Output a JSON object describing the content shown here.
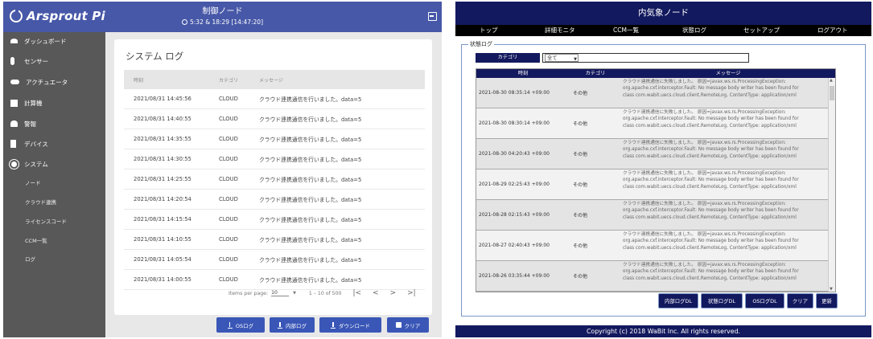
{
  "left": {
    "logo": "Arsprout Pi",
    "title": "制御ノード",
    "status": "5:32 & 18:29 [14:47:20]",
    "sidebar": {
      "items": [
        {
          "label": "ダッシュボード",
          "icon": "dashboard-icon"
        },
        {
          "label": "センサー",
          "icon": "sensor-icon"
        },
        {
          "label": "アクチュエータ",
          "icon": "actuator-icon"
        },
        {
          "label": "計算機",
          "icon": "calculator-icon"
        },
        {
          "label": "警報",
          "icon": "alarm-icon"
        },
        {
          "label": "デバイス",
          "icon": "device-icon"
        },
        {
          "label": "システム",
          "icon": "gear-icon"
        }
      ],
      "sub_items": [
        "ノード",
        "クラウド連携",
        "ライセンスコード",
        "CCM一覧",
        "ログ"
      ]
    },
    "page_title": "システム ログ",
    "table": {
      "headers": {
        "time": "時刻",
        "category": "カテゴリ",
        "message": "メッセージ"
      },
      "rows": [
        {
          "time": "2021/08/31 14:45:56",
          "category": "CLOUD",
          "message": "クラウド連携通信を行いました。data=5"
        },
        {
          "time": "2021/08/31 14:40:55",
          "category": "CLOUD",
          "message": "クラウド連携通信を行いました。data=5"
        },
        {
          "time": "2021/08/31 14:35:55",
          "category": "CLOUD",
          "message": "クラウド連携通信を行いました。data=5"
        },
        {
          "time": "2021/08/31 14:30:55",
          "category": "CLOUD",
          "message": "クラウド連携通信を行いました。data=5"
        },
        {
          "time": "2021/08/31 14:25:55",
          "category": "CLOUD",
          "message": "クラウド連携通信を行いました。data=5"
        },
        {
          "time": "2021/08/31 14:20:54",
          "category": "CLOUD",
          "message": "クラウド連携通信を行いました。data=5"
        },
        {
          "time": "2021/08/31 14:15:54",
          "category": "CLOUD",
          "message": "クラウド連携通信を行いました。data=5"
        },
        {
          "time": "2021/08/31 14:10:55",
          "category": "CLOUD",
          "message": "クラウド連携通信を行いました。data=5"
        },
        {
          "time": "2021/08/31 14:05:54",
          "category": "CLOUD",
          "message": "クラウド連携通信を行いました。data=5"
        },
        {
          "time": "2021/08/31 14:00:55",
          "category": "CLOUD",
          "message": "クラウド連携通信を行いました。data=5"
        }
      ]
    },
    "pager": {
      "items_per_page_label": "Items per page:",
      "items_per_page": "10",
      "range": "1 – 10 of 500",
      "first": "|<",
      "prev": "<",
      "next": ">",
      "last": ">|"
    },
    "buttons": {
      "os_log": "OSログ",
      "internal_log": "内部ログ",
      "download": "ダウンロード",
      "clear": "クリア"
    }
  },
  "right": {
    "title": "内気象ノード",
    "menu": [
      "トップ",
      "詳細モニタ",
      "CCM一覧",
      "状態ログ",
      "セットアップ",
      "ログアウト"
    ],
    "legend": "状態ログ",
    "category_label": "カテゴリ",
    "category_value": "全て",
    "table": {
      "headers": {
        "time": "時刻",
        "category": "カテゴリ",
        "message": "メッセージ"
      },
      "rows": [
        {
          "time": "2021-08-30 08:35:14 +09:00",
          "category": "その他"
        },
        {
          "time": "2021-08-30 08:30:14 +09:00",
          "category": "その他"
        },
        {
          "time": "2021-08-30 04:20:43 +09:00",
          "category": "その他"
        },
        {
          "time": "2021-08-29 02:25:43 +09:00",
          "category": "その他"
        },
        {
          "time": "2021-08-28 02:15:43 +09:00",
          "category": "その他"
        },
        {
          "time": "2021-08-27 02:40:43 +09:00",
          "category": "その他"
        },
        {
          "time": "2021-08-26 03:35:44 +09:00",
          "category": "その他"
        }
      ],
      "message_lines": [
        "クラウド連携通信に失敗しました。 原因=javax.ws.rs.ProcessingException:",
        "org.apache.cxf.interceptor.Fault: No message body writer has been found for",
        "class com.wabit.uecs.cloud.client.RemoteLog, ContentType: application/xml"
      ]
    },
    "buttons": {
      "internal_log_dl": "内部ログDL",
      "state_log_dl": "状態ログDL",
      "os_log_dl": "OSログDL",
      "clear": "クリア",
      "refresh": "更新"
    },
    "footer": "Copyright (c) 2018 WaBit Inc. All rights reserved."
  }
}
